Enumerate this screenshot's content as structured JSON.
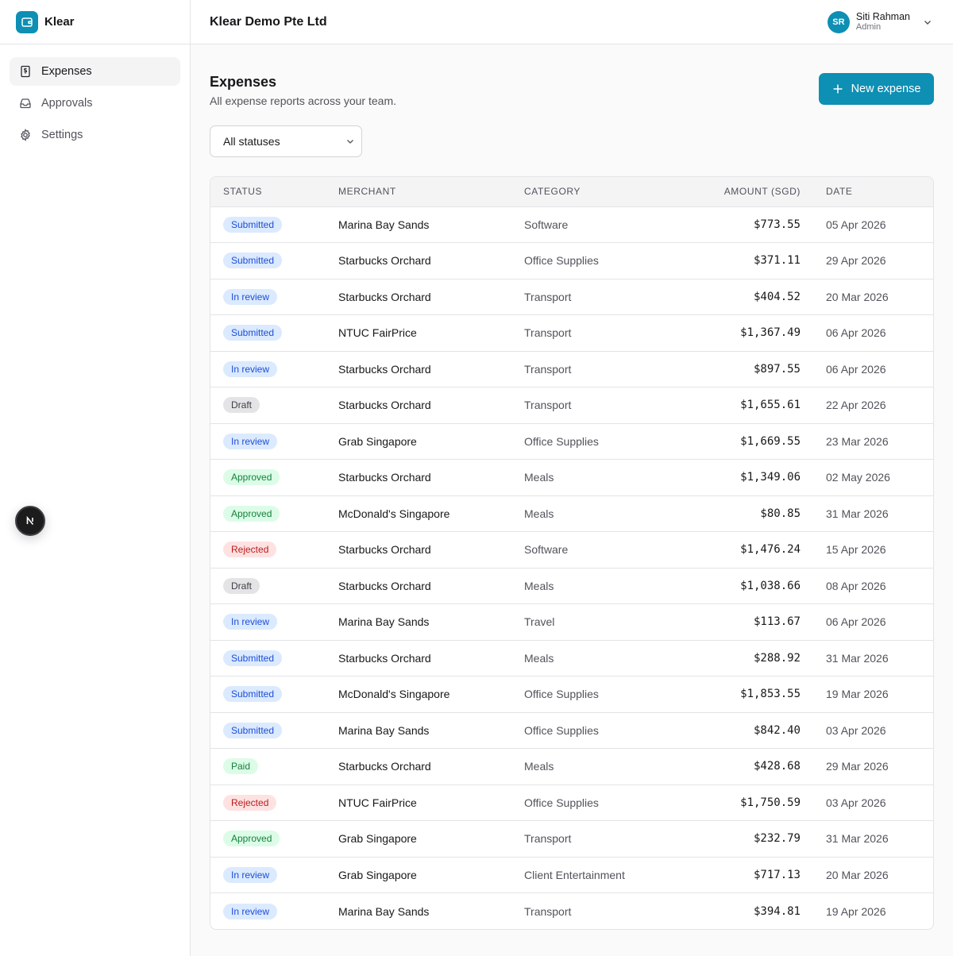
{
  "app": {
    "name": "Klear"
  },
  "org": {
    "name": "Klear Demo Pte Ltd"
  },
  "user": {
    "initials": "SR",
    "name": "Siti Rahman",
    "role": "Admin"
  },
  "nav": [
    {
      "label": "Expenses",
      "icon": "receipt-icon",
      "active": true
    },
    {
      "label": "Approvals",
      "icon": "inbox-icon",
      "active": false
    },
    {
      "label": "Settings",
      "icon": "gear-icon",
      "active": false
    }
  ],
  "page": {
    "title": "Expenses",
    "subtitle": "All expense reports across your team.",
    "new_button": "New expense",
    "filter_value": "All statuses"
  },
  "table": {
    "columns": [
      "STATUS",
      "MERCHANT",
      "CATEGORY",
      "AMOUNT (SGD)",
      "DATE"
    ],
    "rows": [
      {
        "status": "Submitted",
        "merchant": "Marina Bay Sands",
        "category": "Software",
        "amount": "$773.55",
        "date": "05 Apr 2026"
      },
      {
        "status": "Submitted",
        "merchant": "Starbucks Orchard",
        "category": "Office Supplies",
        "amount": "$371.11",
        "date": "29 Apr 2026"
      },
      {
        "status": "In review",
        "merchant": "Starbucks Orchard",
        "category": "Transport",
        "amount": "$404.52",
        "date": "20 Mar 2026"
      },
      {
        "status": "Submitted",
        "merchant": "NTUC FairPrice",
        "category": "Transport",
        "amount": "$1,367.49",
        "date": "06 Apr 2026"
      },
      {
        "status": "In review",
        "merchant": "Starbucks Orchard",
        "category": "Transport",
        "amount": "$897.55",
        "date": "06 Apr 2026"
      },
      {
        "status": "Draft",
        "merchant": "Starbucks Orchard",
        "category": "Transport",
        "amount": "$1,655.61",
        "date": "22 Apr 2026"
      },
      {
        "status": "In review",
        "merchant": "Grab Singapore",
        "category": "Office Supplies",
        "amount": "$1,669.55",
        "date": "23 Mar 2026"
      },
      {
        "status": "Approved",
        "merchant": "Starbucks Orchard",
        "category": "Meals",
        "amount": "$1,349.06",
        "date": "02 May 2026"
      },
      {
        "status": "Approved",
        "merchant": "McDonald's Singapore",
        "category": "Meals",
        "amount": "$80.85",
        "date": "31 Mar 2026"
      },
      {
        "status": "Rejected",
        "merchant": "Starbucks Orchard",
        "category": "Software",
        "amount": "$1,476.24",
        "date": "15 Apr 2026"
      },
      {
        "status": "Draft",
        "merchant": "Starbucks Orchard",
        "category": "Meals",
        "amount": "$1,038.66",
        "date": "08 Apr 2026"
      },
      {
        "status": "In review",
        "merchant": "Marina Bay Sands",
        "category": "Travel",
        "amount": "$113.67",
        "date": "06 Apr 2026"
      },
      {
        "status": "Submitted",
        "merchant": "Starbucks Orchard",
        "category": "Meals",
        "amount": "$288.92",
        "date": "31 Mar 2026"
      },
      {
        "status": "Submitted",
        "merchant": "McDonald's Singapore",
        "category": "Office Supplies",
        "amount": "$1,853.55",
        "date": "19 Mar 2026"
      },
      {
        "status": "Submitted",
        "merchant": "Marina Bay Sands",
        "category": "Office Supplies",
        "amount": "$842.40",
        "date": "03 Apr 2026"
      },
      {
        "status": "Paid",
        "merchant": "Starbucks Orchard",
        "category": "Meals",
        "amount": "$428.68",
        "date": "29 Mar 2026"
      },
      {
        "status": "Rejected",
        "merchant": "NTUC FairPrice",
        "category": "Office Supplies",
        "amount": "$1,750.59",
        "date": "03 Apr 2026"
      },
      {
        "status": "Approved",
        "merchant": "Grab Singapore",
        "category": "Transport",
        "amount": "$232.79",
        "date": "31 Mar 2026"
      },
      {
        "status": "In review",
        "merchant": "Grab Singapore",
        "category": "Client Entertainment",
        "amount": "$717.13",
        "date": "20 Mar 2026"
      },
      {
        "status": "In review",
        "merchant": "Marina Bay Sands",
        "category": "Transport",
        "amount": "$394.81",
        "date": "19 Apr 2026"
      }
    ]
  },
  "dev_badge": {
    "letter": "N"
  },
  "colors": {
    "accent": "#0e8fb4",
    "submitted": "#1d4ed8",
    "approved": "#15803d",
    "rejected": "#b91c1c",
    "draft": "#3f3f46"
  }
}
